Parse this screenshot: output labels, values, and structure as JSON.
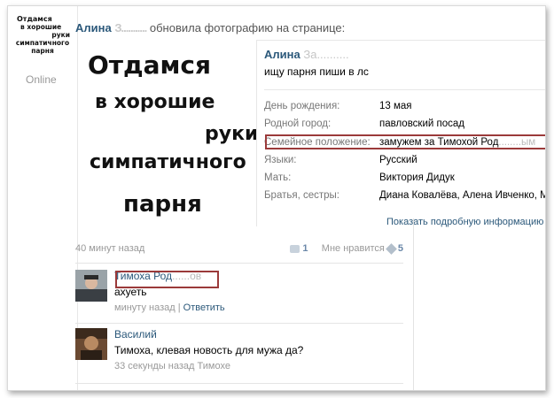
{
  "sidebar": {
    "avatar_lines": [
      "Отдамся",
      "в хорошие",
      "руки",
      "симпатичного",
      "парня"
    ],
    "online_label": "Online"
  },
  "post": {
    "author_first": "Алина",
    "author_blur": "З...........",
    "action": "обновила фотографию на странице:",
    "image_lines": [
      "Отдамся",
      "в хорошие",
      "руки",
      "симпатичного",
      "парня"
    ],
    "time": "40 минут назад",
    "share_count": "1",
    "like_label": "Мне нравится",
    "like_count": "5"
  },
  "profile": {
    "name_first": "Алина",
    "name_blur": "За..........",
    "status": "ищу парня пиши в лс",
    "fields": [
      {
        "label": "День рождения:",
        "value": "13 мая"
      },
      {
        "label": "Родной город:",
        "value": "павловский посад"
      },
      {
        "label": "Семейное положение:",
        "value": "замужем за Тимохой Род",
        "value_blur": "........ым"
      },
      {
        "label": "Языки:",
        "value": "Русский"
      },
      {
        "label": "Мать:",
        "value": "Виктория Дидук"
      },
      {
        "label": "Братья, сестры:",
        "value": "Диана Ковалёва, Алена Ивченко, Мих"
      }
    ],
    "more_link": "Показать подробную информацию"
  },
  "comments": [
    {
      "author": "Тимоха Род",
      "author_blur": "......ов",
      "text": "ахуеть",
      "time": "минуту назад",
      "sep": "|",
      "reply": "Ответить"
    },
    {
      "author": "Василий",
      "text": "Тимоха, клевая новость для мужа да?",
      "time": "33 секунды назад Тимохе"
    }
  ],
  "colors": {
    "link": "#2b587a",
    "muted": "#999999",
    "highlight_box": "#9b3a3a"
  }
}
